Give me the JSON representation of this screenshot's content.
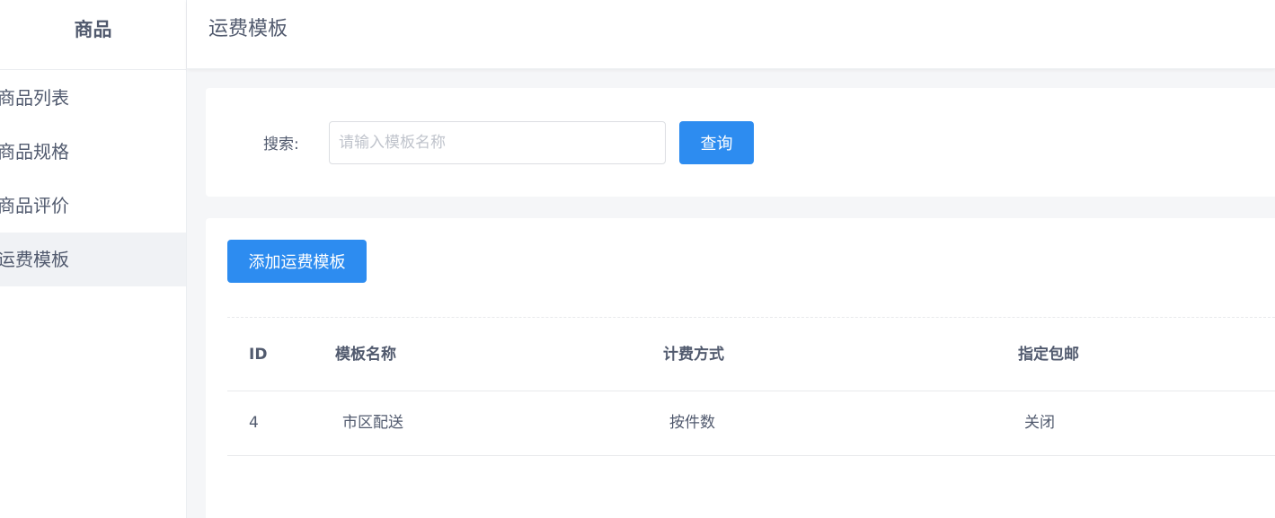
{
  "sidebar": {
    "title": "商品",
    "items": [
      {
        "label": "商品列表"
      },
      {
        "label": "商品规格"
      },
      {
        "label": "商品评价"
      },
      {
        "label": "运费模板",
        "active": true
      }
    ]
  },
  "header": {
    "title": "运费模板"
  },
  "search": {
    "label": "搜索:",
    "placeholder": "请输入模板名称",
    "value": "",
    "button_label": "查询"
  },
  "toolbar": {
    "add_label": "添加运费模板"
  },
  "table": {
    "columns": [
      "ID",
      "模板名称",
      "计费方式",
      "指定包邮"
    ],
    "rows": [
      {
        "id": "4",
        "name": "市区配送",
        "billing": "按件数",
        "free_shipping": "关闭"
      }
    ]
  },
  "colors": {
    "primary": "#2d8cf0",
    "text": "#515a6e",
    "background": "#f5f6f8",
    "active_menu_bg": "#f0f2f5"
  }
}
